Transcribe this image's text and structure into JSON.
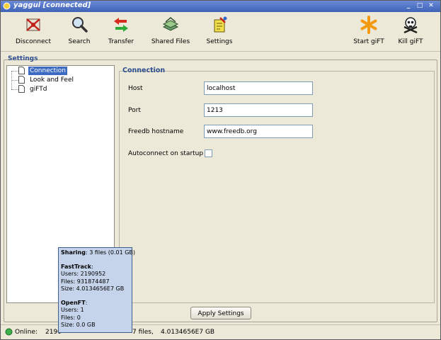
{
  "window": {
    "title": "yaggui [connected]",
    "buttons": {
      "minimize": "_",
      "maximize": "□",
      "close": "✕"
    }
  },
  "toolbar": {
    "disconnect": {
      "label": "Disconnect",
      "icon": "disconnect-icon"
    },
    "search": {
      "label": "Search",
      "icon": "magnifier-icon"
    },
    "transfer": {
      "label": "Transfer",
      "icon": "transfer-arrows-icon"
    },
    "shared_files": {
      "label": "Shared Files",
      "icon": "shared-files-icon"
    },
    "settings": {
      "label": "Settings",
      "icon": "settings-icon"
    },
    "start_gift": {
      "label": "Start giFT",
      "icon": "asterisk-icon"
    },
    "kill_gift": {
      "label": "Kill giFT",
      "icon": "skull-icon"
    }
  },
  "settings": {
    "group_label": "Settings",
    "tree": [
      "Connection",
      "Look and Feel",
      "giFTd"
    ],
    "selected": "Connection"
  },
  "connection": {
    "title": "Connection",
    "host_label": "Host",
    "host_value": "localhost",
    "port_label": "Port",
    "port_value": "1213",
    "freedb_label": "Freedb hostname",
    "freedb_value": "www.freedb.org",
    "autoconnect_label": "Autoconnect on startup",
    "autoconnect_checked": false
  },
  "apply_button": "Apply Settings",
  "status": {
    "state": "Online:",
    "users_partial": "2190",
    "files": "7 files,",
    "size": "4.0134656E7 GB"
  },
  "tooltip": {
    "sharing_label": "Sharing",
    "sharing_value": ": 3 files (0.01 GB)",
    "fasttrack_label": "FastTrack",
    "fasttrack_colon": ":",
    "ft_users": "Users: 2190952",
    "ft_files": "Files: 931874487",
    "ft_size": "Size: 4.0134656E7 GB",
    "openft_label": "OpenFT",
    "openft_colon": ":",
    "oft_users": "Users: 1",
    "oft_files": "Files: 0",
    "oft_size": "Size: 0.0 GB"
  },
  "colors": {
    "titlebar": "#3e63b8",
    "selection": "#3d6bc2",
    "group_title": "#2c4d8f",
    "tooltip_bg": "#c5d4ea"
  }
}
